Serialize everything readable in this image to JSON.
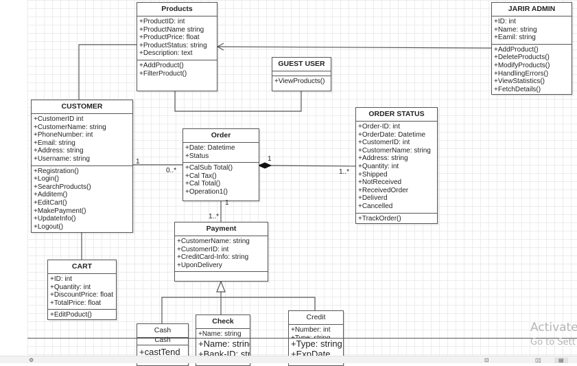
{
  "diagram": {
    "classes": {
      "products": {
        "name": "Products",
        "attributes": [
          "+ProductID: int",
          "+ProductName string",
          "+ProductPrice: float",
          "+ProductStatus: string",
          "+Description: text"
        ],
        "methods": [
          "+AddProduct()",
          "+FilterProduct()"
        ]
      },
      "jarir_admin": {
        "name": "JARIR ADMIN",
        "attributes": [
          "+ID: int",
          "+Name: string",
          "+Eamil: string"
        ],
        "methods": [
          "+AddProduct()",
          "+DeleteProducts()",
          "+ModifyProducts()",
          "+HandlingErrors()",
          "+ViewStatistics()",
          "+FetchDetails()"
        ]
      },
      "guest_user": {
        "name": "GUEST USER",
        "attributes": [],
        "methods": [
          "+ViewProducts()"
        ]
      },
      "customer": {
        "name": "CUSTOMER",
        "attributes": [
          "+CustomerID int",
          "+CustomerName: string",
          "+PhoneNumber: int",
          "+Email: string",
          "+Address: string",
          "+Username: string"
        ],
        "methods": [
          "+Registration()",
          "+Login()",
          "+SearchProducts()",
          "+Additem()",
          "+EditCart()",
          "+MakePayment()",
          "+UpdateInfo()",
          "+Logout()"
        ]
      },
      "order": {
        "name": "Order",
        "attributes": [
          "+Date: Datetime",
          "+Status"
        ],
        "methods": [
          "+CalSub Total()",
          "+Cal Tax()",
          "+Cal Total()",
          "+Operation1()"
        ]
      },
      "order_status": {
        "name": "ORDER STATUS",
        "attributes": [
          "+Order-ID: int",
          "+OrderDate: Datetime",
          "+CustomerID: int",
          "+CustomerName: string",
          "+Address: string",
          "+Quantity: int",
          "+Shipped",
          "+NotReceived",
          "+ReceivedOrder",
          "+Deliverd",
          "+Cancelled"
        ],
        "methods": [
          "+TrackOrder()"
        ]
      },
      "payment": {
        "name": "Payment",
        "attributes": [
          "+CustomerName: string",
          "+CustomerID: int",
          "+CreditCard-Info: string",
          "+UponDelivery"
        ],
        "methods": []
      },
      "cart": {
        "name": "CART",
        "attributes": [
          "+ID: int",
          "+Quantity: int",
          "+DiscountPrice: float",
          "+TotalPrice: float"
        ],
        "methods": [
          "+EditPoduct()"
        ]
      },
      "cash": {
        "name": "Cash",
        "ghost_title": "Cash",
        "attributes": [
          "+castTend"
        ]
      },
      "check": {
        "name": "Check",
        "attributes": [
          "+Name: string"
        ],
        "ghost_attributes": [
          "+Name: string",
          "+Bank-ID: string"
        ]
      },
      "credit": {
        "name": "Credit",
        "attributes": [
          "+Number: int",
          "+Type: string"
        ],
        "ghost_attributes": [
          "+Type: string",
          "+ExpDate"
        ]
      }
    },
    "multiplicities": {
      "customer_order_left": "1",
      "customer_order_right": "0..*",
      "order_status_left": "1",
      "order_status_right": "1..*",
      "order_payment_top": "1",
      "order_payment_bottom": "1..*"
    }
  },
  "watermark": {
    "line1": "Activate",
    "line2": "Go to Sett"
  },
  "statusbar": {
    "icons": [
      "gear-icon",
      "fit-page-icon",
      "book-icon",
      "page-view-icon"
    ]
  }
}
